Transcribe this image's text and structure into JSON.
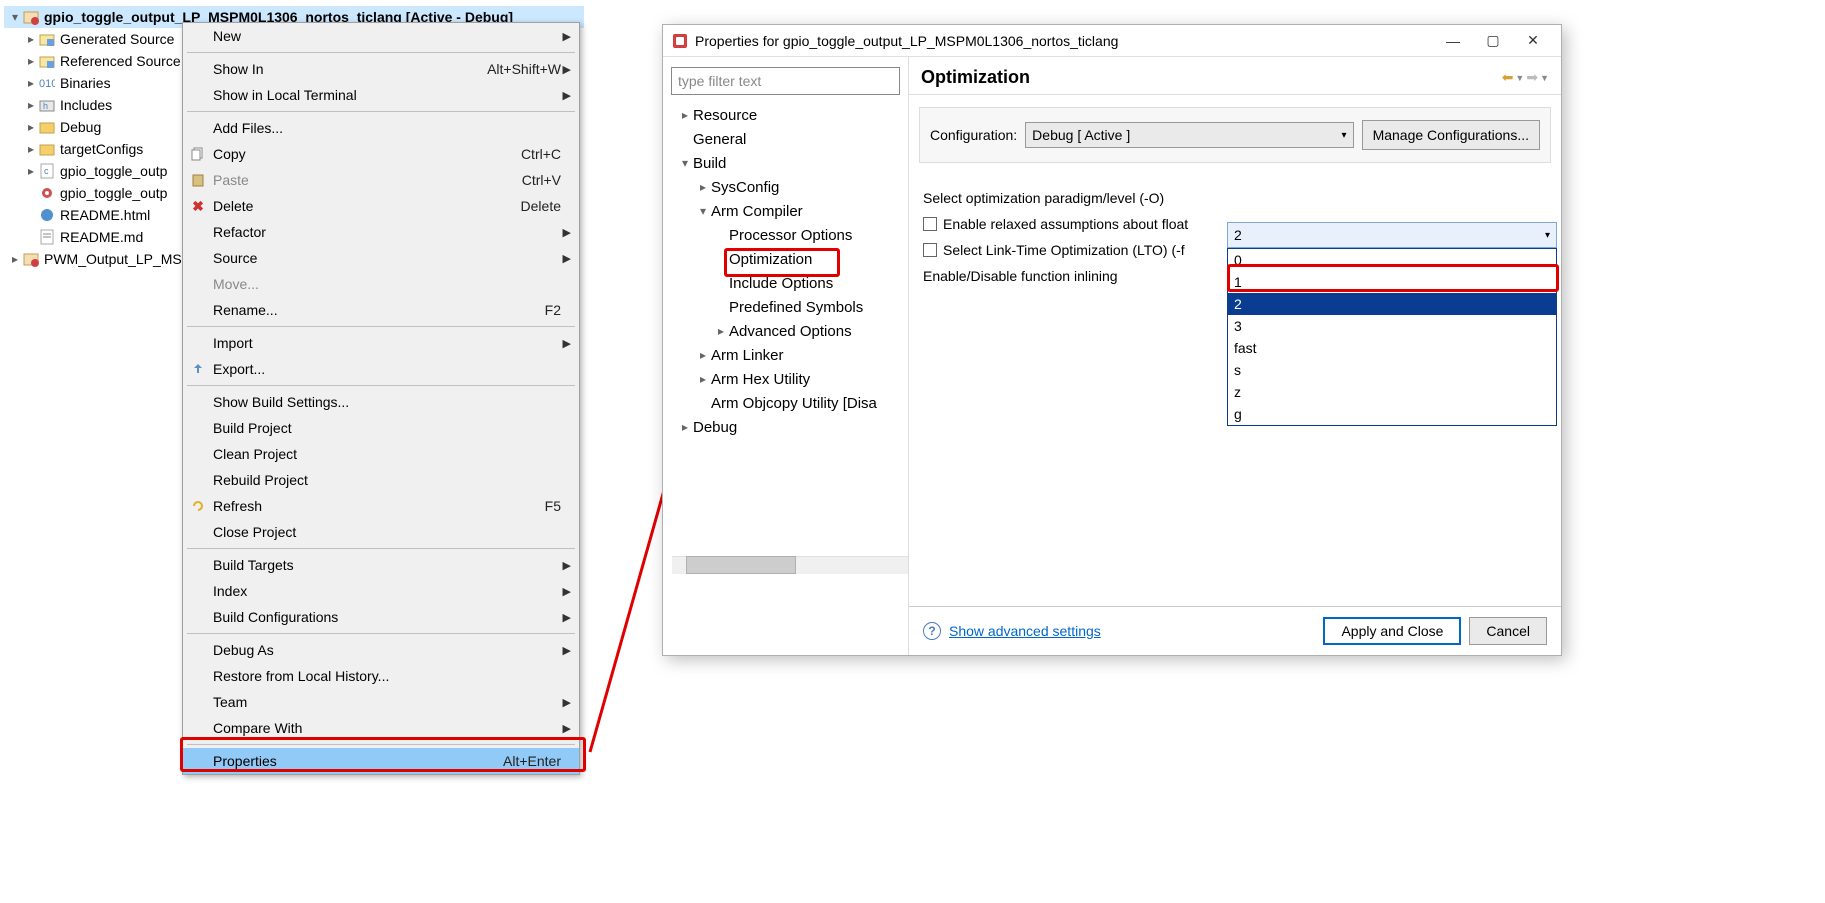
{
  "project": {
    "title": "gpio_toggle_output_LP_MSPM0L1306_nortos_ticlang  [Active - Debug]",
    "items": [
      {
        "label": "Generated Source",
        "icon": "folder-gen"
      },
      {
        "label": "Referenced Source",
        "icon": "folder-gen"
      },
      {
        "label": "Binaries",
        "icon": "bin"
      },
      {
        "label": "Includes",
        "icon": "inc"
      },
      {
        "label": "Debug",
        "icon": "folder"
      },
      {
        "label": "targetConfigs",
        "icon": "folder"
      },
      {
        "label": "gpio_toggle_outp",
        "icon": "cfile"
      },
      {
        "label": "gpio_toggle_outp",
        "icon": "gear"
      },
      {
        "label": "README.html",
        "icon": "html"
      },
      {
        "label": "README.md",
        "icon": "md"
      }
    ],
    "other": "PWM_Output_LP_MS"
  },
  "ctxmenu": {
    "groups": [
      [
        {
          "label": "New",
          "sub": true
        }
      ],
      [
        {
          "label": "Show In",
          "shortcut": "Alt+Shift+W",
          "sub": true
        },
        {
          "label": "Show in Local Terminal",
          "sub": true
        }
      ],
      [
        {
          "label": "Add Files..."
        },
        {
          "label": "Copy",
          "shortcut": "Ctrl+C",
          "icon": "copy"
        },
        {
          "label": "Paste",
          "shortcut": "Ctrl+V",
          "icon": "paste",
          "disabled": true
        },
        {
          "label": "Delete",
          "shortcut": "Delete",
          "icon": "delete"
        },
        {
          "label": "Refactor",
          "sub": true
        },
        {
          "label": "Source",
          "sub": true
        },
        {
          "label": "Move...",
          "disabled": true
        },
        {
          "label": "Rename...",
          "shortcut": "F2"
        }
      ],
      [
        {
          "label": "Import",
          "sub": true
        },
        {
          "label": "Export...",
          "icon": "export"
        }
      ],
      [
        {
          "label": "Show Build Settings..."
        },
        {
          "label": "Build Project"
        },
        {
          "label": "Clean Project"
        },
        {
          "label": "Rebuild Project"
        },
        {
          "label": "Refresh",
          "shortcut": "F5",
          "icon": "refresh"
        },
        {
          "label": "Close Project"
        }
      ],
      [
        {
          "label": "Build Targets",
          "sub": true
        },
        {
          "label": "Index",
          "sub": true
        },
        {
          "label": "Build Configurations",
          "sub": true
        }
      ],
      [
        {
          "label": "Debug As",
          "sub": true
        },
        {
          "label": "Restore from Local History..."
        },
        {
          "label": "Team",
          "sub": true
        },
        {
          "label": "Compare With",
          "sub": true
        }
      ],
      [
        {
          "label": "Properties",
          "shortcut": "Alt+Enter",
          "hl": true
        }
      ]
    ]
  },
  "dialog": {
    "title": "Properties for gpio_toggle_output_LP_MSPM0L1306_nortos_ticlang",
    "filter_placeholder": "type filter text",
    "nav": [
      {
        "label": "Resource",
        "depth": 1,
        "chev": ">"
      },
      {
        "label": "General",
        "depth": 1
      },
      {
        "label": "Build",
        "depth": 1,
        "chev": "v"
      },
      {
        "label": "SysConfig",
        "depth": 2,
        "chev": ">"
      },
      {
        "label": "Arm Compiler",
        "depth": 2,
        "chev": "v"
      },
      {
        "label": "Processor Options",
        "depth": 3
      },
      {
        "label": "Optimization",
        "depth": 3,
        "hl": true
      },
      {
        "label": "Include Options",
        "depth": 3
      },
      {
        "label": "Predefined Symbols",
        "depth": 3
      },
      {
        "label": "Advanced Options",
        "depth": 3,
        "chev": ">"
      },
      {
        "label": "Arm Linker",
        "depth": 2,
        "chev": ">"
      },
      {
        "label": "Arm Hex Utility",
        "depth": 2,
        "chev": ">"
      },
      {
        "label": "Arm Objcopy Utility  [Disa",
        "depth": 2
      },
      {
        "label": "Debug",
        "depth": 1,
        "chev": ">"
      }
    ],
    "header": "Optimization",
    "config_label": "Configuration:",
    "config_value": "Debug  [ Active ]",
    "manage_btn": "Manage Configurations...",
    "opts": {
      "level_label": "Select optimization paradigm/level (-O)",
      "level_value": "2",
      "relaxed": "Enable relaxed assumptions about float",
      "lto": "Select Link-Time Optimization (LTO) (-f",
      "inline": "Enable/Disable function inlining"
    },
    "dropdown": [
      "0",
      "1",
      "2",
      "3",
      "fast",
      "s",
      "z",
      "g"
    ],
    "adv_link": "Show advanced settings",
    "apply": "Apply and Close",
    "cancel": "Cancel"
  }
}
